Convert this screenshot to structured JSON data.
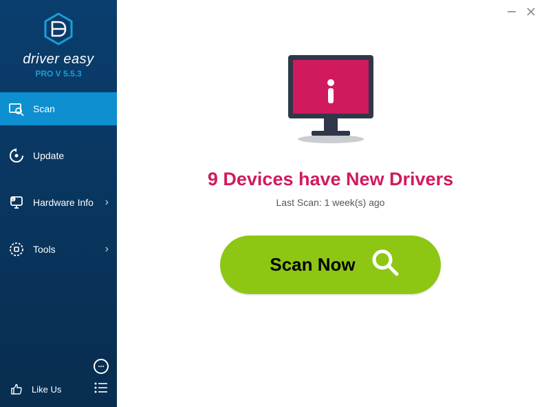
{
  "brand": {
    "name": "driver easy",
    "version": "PRO V 5.5.3"
  },
  "sidebar": {
    "items": [
      {
        "label": "Scan",
        "has_chevron": false,
        "active": true
      },
      {
        "label": "Update",
        "has_chevron": false,
        "active": false
      },
      {
        "label": "Hardware Info",
        "has_chevron": true,
        "active": false
      },
      {
        "label": "Tools",
        "has_chevron": true,
        "active": false
      }
    ],
    "like_label": "Like Us"
  },
  "main": {
    "headline": "9 Devices have New Drivers",
    "last_scan": "Last Scan: 1 week(s) ago",
    "scan_button": "Scan Now"
  },
  "colors": {
    "accent": "#0d8fd0",
    "headline": "#d11a5e",
    "button": "#8dc713"
  }
}
